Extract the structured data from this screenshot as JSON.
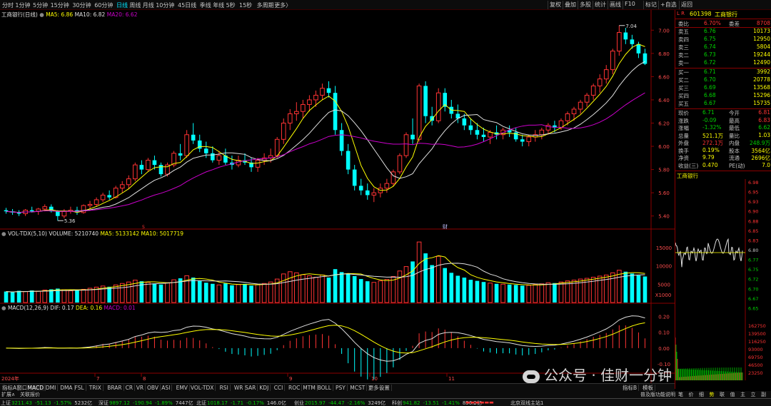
{
  "top_bar": {
    "periods": [
      "分时",
      "1分钟",
      "5分钟",
      "15分钟",
      "30分钟",
      "60分钟",
      "日线",
      "周线",
      "月线",
      "10分钟",
      "45日线",
      "季线",
      "年线",
      "5秒",
      "15秒",
      "多周期",
      "更多〉"
    ],
    "active_period": "日线",
    "tools": [
      "复权",
      "叠加",
      "多股",
      "统计",
      "画线",
      "F10",
      "标记",
      "+自选",
      "返回"
    ]
  },
  "main_chart": {
    "title": "工商银行(日线)",
    "ma5_label": "MA5: 6.86",
    "ma10_label": "MA10: 6.82",
    "ma20_label": "MA20: 6.62",
    "y_ticks": [
      "7.00",
      "6.80",
      "6.60",
      "6.40",
      "6.20",
      "6.00",
      "5.80",
      "5.60",
      "5.40"
    ],
    "high_marker": "7.04",
    "low_marker": "5.36",
    "event_marker": "财",
    "s_marker": "S"
  },
  "volume_chart": {
    "title": "VOL-TDX(5,10)",
    "volume_label": "VOLUME: 5210740",
    "ma5_label": "MA5: 5133142",
    "ma10_label": "MA10: 5017719",
    "y_ticks": [
      "15000",
      "10000",
      "5000"
    ],
    "unit": "X1000"
  },
  "macd_chart": {
    "title": "MACD(12,26,9)",
    "dif_label": "DIF: 0.17",
    "dea_label": "DEA: 0.16",
    "macd_label": "MACD: 0.01",
    "y_ticks": [
      "0.20",
      "0.10",
      "0.00",
      "-0.10"
    ]
  },
  "x_axis": {
    "labels": [
      "2024年",
      "7",
      "8",
      "9",
      "10",
      "11"
    ]
  },
  "chart_data": {
    "type": "candlestick",
    "title": "工商银行(日线)",
    "y_range": [
      5.36,
      7.04
    ],
    "price_ticks": [
      7.0,
      6.8,
      6.6,
      6.4,
      6.2,
      6.0,
      5.8,
      5.6,
      5.4
    ],
    "ohlc_approx": [
      [
        5.45,
        5.47,
        5.42,
        5.44
      ],
      [
        5.44,
        5.46,
        5.41,
        5.43
      ],
      [
        5.43,
        5.45,
        5.4,
        5.42
      ],
      [
        5.42,
        5.46,
        5.4,
        5.45
      ],
      [
        5.45,
        5.48,
        5.43,
        5.44
      ],
      [
        5.44,
        5.47,
        5.41,
        5.46
      ],
      [
        5.46,
        5.5,
        5.44,
        5.48
      ],
      [
        5.48,
        5.5,
        5.43,
        5.44
      ],
      [
        5.44,
        5.45,
        5.36,
        5.4
      ],
      [
        5.4,
        5.46,
        5.38,
        5.44
      ],
      [
        5.44,
        5.48,
        5.42,
        5.45
      ],
      [
        5.45,
        5.48,
        5.41,
        5.43
      ],
      [
        5.43,
        5.5,
        5.42,
        5.49
      ],
      [
        5.49,
        5.53,
        5.46,
        5.5
      ],
      [
        5.5,
        5.56,
        5.48,
        5.54
      ],
      [
        5.54,
        5.6,
        5.52,
        5.58
      ],
      [
        5.58,
        5.62,
        5.54,
        5.56
      ],
      [
        5.56,
        5.66,
        5.55,
        5.64
      ],
      [
        5.64,
        5.7,
        5.6,
        5.67
      ],
      [
        5.67,
        5.75,
        5.63,
        5.72
      ],
      [
        5.72,
        5.86,
        5.7,
        5.84
      ],
      [
        5.84,
        5.88,
        5.76,
        5.8
      ],
      [
        5.8,
        5.9,
        5.78,
        5.88
      ],
      [
        5.88,
        5.92,
        5.8,
        5.84
      ],
      [
        5.84,
        5.86,
        5.74,
        5.76
      ],
      [
        5.76,
        5.86,
        5.74,
        5.84
      ],
      [
        5.84,
        5.96,
        5.82,
        5.94
      ],
      [
        5.94,
        6.02,
        5.88,
        5.92
      ],
      [
        5.92,
        6.14,
        5.9,
        6.1
      ],
      [
        6.1,
        6.2,
        6.02,
        6.05
      ],
      [
        6.05,
        6.1,
        5.95,
        5.98
      ],
      [
        5.98,
        6.04,
        5.9,
        5.94
      ],
      [
        5.94,
        6.0,
        5.86,
        5.88
      ],
      [
        5.88,
        5.96,
        5.84,
        5.92
      ],
      [
        5.92,
        5.98,
        5.84,
        5.86
      ],
      [
        5.86,
        5.92,
        5.8,
        5.84
      ],
      [
        5.84,
        5.92,
        5.82,
        5.88
      ],
      [
        5.88,
        5.94,
        5.84,
        5.86
      ],
      [
        5.86,
        5.9,
        5.78,
        5.82
      ],
      [
        5.82,
        5.9,
        5.78,
        5.88
      ],
      [
        5.88,
        5.94,
        5.84,
        5.9
      ],
      [
        5.9,
        5.98,
        5.86,
        5.92
      ],
      [
        5.92,
        6.08,
        5.9,
        6.06
      ],
      [
        6.06,
        6.24,
        6.02,
        6.2
      ],
      [
        6.2,
        6.32,
        6.14,
        6.28
      ],
      [
        6.28,
        6.38,
        6.22,
        6.3
      ],
      [
        6.3,
        6.4,
        6.24,
        6.36
      ],
      [
        6.36,
        6.44,
        6.3,
        6.4
      ],
      [
        6.4,
        6.48,
        6.34,
        6.44
      ],
      [
        6.44,
        6.54,
        6.4,
        6.5
      ],
      [
        6.5,
        6.56,
        6.42,
        6.46
      ],
      [
        6.46,
        6.52,
        6.1,
        6.14
      ],
      [
        6.14,
        6.2,
        5.92,
        5.96
      ],
      [
        5.96,
        6.02,
        5.76,
        5.8
      ],
      [
        5.8,
        5.84,
        5.62,
        5.66
      ],
      [
        5.66,
        5.72,
        5.58,
        5.62
      ],
      [
        5.62,
        5.68,
        5.54,
        5.58
      ],
      [
        5.58,
        5.64,
        5.52,
        5.6
      ],
      [
        5.6,
        5.68,
        5.56,
        5.64
      ],
      [
        5.64,
        5.72,
        5.6,
        5.68
      ],
      [
        5.68,
        5.8,
        5.66,
        5.78
      ],
      [
        5.78,
        5.94,
        5.76,
        5.92
      ],
      [
        5.92,
        6.12,
        5.9,
        6.1
      ],
      [
        6.1,
        6.24,
        6.02,
        6.06
      ],
      [
        6.06,
        6.54,
        6.04,
        6.52
      ],
      [
        6.52,
        6.56,
        6.2,
        6.26
      ],
      [
        6.26,
        6.34,
        6.18,
        6.22
      ],
      [
        6.22,
        6.5,
        6.2,
        6.46
      ],
      [
        6.46,
        6.5,
        6.3,
        6.34
      ],
      [
        6.34,
        6.4,
        6.24,
        6.28
      ],
      [
        6.28,
        6.36,
        6.2,
        6.24
      ],
      [
        6.24,
        6.28,
        6.14,
        6.18
      ],
      [
        6.18,
        6.24,
        6.1,
        6.14
      ],
      [
        6.14,
        6.2,
        6.06,
        6.1
      ],
      [
        6.1,
        6.16,
        6.04,
        6.08
      ],
      [
        6.08,
        6.14,
        6.02,
        6.12
      ],
      [
        6.12,
        6.18,
        6.06,
        6.1
      ],
      [
        6.1,
        6.16,
        6.06,
        6.14
      ],
      [
        6.14,
        6.18,
        6.08,
        6.12
      ],
      [
        6.12,
        6.16,
        6.04,
        6.06
      ],
      [
        6.06,
        6.1,
        6.0,
        6.04
      ],
      [
        6.04,
        6.1,
        6.0,
        6.08
      ],
      [
        6.08,
        6.14,
        6.04,
        6.1
      ],
      [
        6.1,
        6.16,
        6.06,
        6.14
      ],
      [
        6.14,
        6.2,
        6.1,
        6.18
      ],
      [
        6.18,
        6.22,
        6.12,
        6.16
      ],
      [
        6.16,
        6.24,
        6.14,
        6.22
      ],
      [
        6.22,
        6.3,
        6.18,
        6.28
      ],
      [
        6.28,
        6.34,
        6.22,
        6.32
      ],
      [
        6.32,
        6.4,
        6.28,
        6.38
      ],
      [
        6.38,
        6.46,
        6.34,
        6.44
      ],
      [
        6.44,
        6.54,
        6.4,
        6.52
      ],
      [
        6.52,
        6.62,
        6.46,
        6.58
      ],
      [
        6.58,
        6.7,
        6.54,
        6.66
      ],
      [
        6.66,
        6.84,
        6.62,
        6.82
      ],
      [
        6.82,
        7.04,
        6.78,
        6.98
      ],
      [
        6.98,
        7.02,
        6.88,
        6.92
      ],
      [
        6.92,
        6.96,
        6.84,
        6.88
      ],
      [
        6.88,
        6.9,
        6.76,
        6.8
      ],
      [
        6.8,
        6.84,
        6.7,
        6.71
      ]
    ],
    "volume_approx": [
      3,
      2.8,
      3.2,
      3,
      3.3,
      3.1,
      3.4,
      3.6,
      3.8,
      3.5,
      3.2,
      3.3,
      3.6,
      3.9,
      4.2,
      4.5,
      4.3,
      4.8,
      5.2,
      5.6,
      6.1,
      5.8,
      5.5,
      5.2,
      4.9,
      5.4,
      6.2,
      6.6,
      7.3,
      6.8,
      5.9,
      5.4,
      5.1,
      4.8,
      5.2,
      4.7,
      4.9,
      5.1,
      4.6,
      4.9,
      5.2,
      5.6,
      6.4,
      7.8,
      8.4,
      8.1,
      7.6,
      7.3,
      6.9,
      7.5,
      6.8,
      9.1,
      8.3,
      7.9,
      7.2,
      6.4,
      5.8,
      5.5,
      5.9,
      6.3,
      7.1,
      8.6,
      9.8,
      11.2,
      16.5,
      13.4,
      10.2,
      12.6,
      9.4,
      8.1,
      7.3,
      6.8,
      6.2,
      5.9,
      5.6,
      5.3,
      5.1,
      5.0,
      4.9,
      4.8,
      4.6,
      4.7,
      4.9,
      5.1,
      5.4,
      5.3,
      5.6,
      5.9,
      6.1,
      6.4,
      6.6,
      6.9,
      7.2,
      7.5,
      8.1,
      8.8,
      8.4,
      7.9,
      7.4,
      7.1
    ],
    "ma5": "yellow",
    "ma10": "white",
    "ma20": "magenta"
  },
  "right_panel": {
    "stock_code": "601398",
    "stock_name": "工商银行",
    "ratio_label": "委比",
    "ratio_value": "6.70%",
    "diff_label": "委差",
    "diff_value": "8708",
    "sells": [
      {
        "label": "卖五",
        "price": "6.76",
        "vol": "10173"
      },
      {
        "label": "卖四",
        "price": "6.75",
        "vol": "12950"
      },
      {
        "label": "卖三",
        "price": "6.74",
        "vol": "5804"
      },
      {
        "label": "卖二",
        "price": "6.73",
        "vol": "19244"
      },
      {
        "label": "卖一",
        "price": "6.72",
        "vol": "12490"
      }
    ],
    "buys": [
      {
        "label": "买一",
        "price": "6.71",
        "vol": "3992"
      },
      {
        "label": "买二",
        "price": "6.70",
        "vol": "20778"
      },
      {
        "label": "买三",
        "price": "6.69",
        "vol": "13568"
      },
      {
        "label": "买四",
        "price": "6.68",
        "vol": "15296"
      },
      {
        "label": "买五",
        "price": "6.67",
        "vol": "15735"
      }
    ],
    "stats": [
      {
        "l1": "现价",
        "v1": "6.71",
        "l2": "今开",
        "v2": "6.81"
      },
      {
        "l1": "涨跌",
        "v1": "-0.09",
        "l2": "最高",
        "v2": "6.83"
      },
      {
        "l1": "涨幅",
        "v1": "-1.32%",
        "l2": "最低",
        "v2": "6.62"
      },
      {
        "l1": "总量",
        "v1": "521.1万",
        "l2": "量比",
        "v2": "1.03"
      },
      {
        "l1": "外盘",
        "v1": "272.1万",
        "l2": "内盘",
        "v2": "248.9万"
      },
      {
        "l1": "换手",
        "v1": "0.19%",
        "l2": "股本",
        "v2": "3564亿"
      },
      {
        "l1": "净资",
        "v1": "9.79",
        "l2": "流通",
        "v2": "2696亿"
      },
      {
        "l1": "收益(三)",
        "v1": "0.470",
        "l2": "PE(动)",
        "v2": "7.0"
      }
    ],
    "mini_title": "工商银行",
    "mini_ticks": [
      "6.98",
      "6.95",
      "6.93",
      "6.90",
      "6.88",
      "6.85",
      "6.83",
      "6.80",
      "6.77",
      "6.75",
      "6.72",
      "6.70",
      "6.67",
      "6.65"
    ],
    "mini_vol_ticks": [
      "162750",
      "139500",
      "116250",
      "93000",
      "69750",
      "46500",
      "23250"
    ],
    "bottom_tabs": [
      "笔",
      "价",
      "细",
      "势",
      "联",
      "值",
      "主",
      "立",
      "副"
    ]
  },
  "indicator_tabs": [
    "指标A",
    "窗口",
    "MACD",
    "DMI",
    "DMA",
    "FSL",
    "TRIX",
    "BRAR",
    "CR",
    "VR",
    "OBV",
    "ASI",
    "EMV",
    "VOL-TDX",
    "RSI",
    "WR",
    "SAR",
    "KDJ",
    "CCI",
    "ROC",
    "MTM",
    "BOLL",
    "PSY",
    "MCST",
    "更多",
    "设置"
  ],
  "indicator_tabs_right": [
    "指标B",
    "模板"
  ],
  "status_bar": {
    "left": "扩展∧",
    "quote": "关联报价",
    "right_tools": "普及版功能说明",
    "right_tabs": [
      "笔",
      "价",
      "细",
      "势",
      "联",
      "值",
      "主",
      "立",
      "副"
    ]
  },
  "index_bar": [
    {
      "name": "上证",
      "value": "3211.43",
      "chg": "-51.13",
      "pct": "-1.57%",
      "amt": "5232亿"
    },
    {
      "name": "深证",
      "value": "9897.12",
      "chg": "-190.94",
      "pct": "-1.89%",
      "amt": "7447亿"
    },
    {
      "name": "北证",
      "value": "1018.17",
      "chg": "-1.71",
      "pct": "-0.17%",
      "amt": "146.0亿"
    },
    {
      "name": "创业",
      "value": "2015.97",
      "chg": "-44.47",
      "pct": "-2.16%",
      "amt": "3249亿"
    },
    {
      "name": "科创",
      "value": "941.82",
      "chg": "-13.51",
      "pct": "-1.41%",
      "amt": "856.2亿"
    }
  ],
  "server": "北京双线主站1",
  "watermark": "公众号 · 佳财一分钟",
  "colors": {
    "up": "#ff3333",
    "down": "#00ffff",
    "ma5": "#ffff00",
    "ma10": "#e0e0e0",
    "ma20": "#cc00cc",
    "grid": "#8b0000"
  }
}
